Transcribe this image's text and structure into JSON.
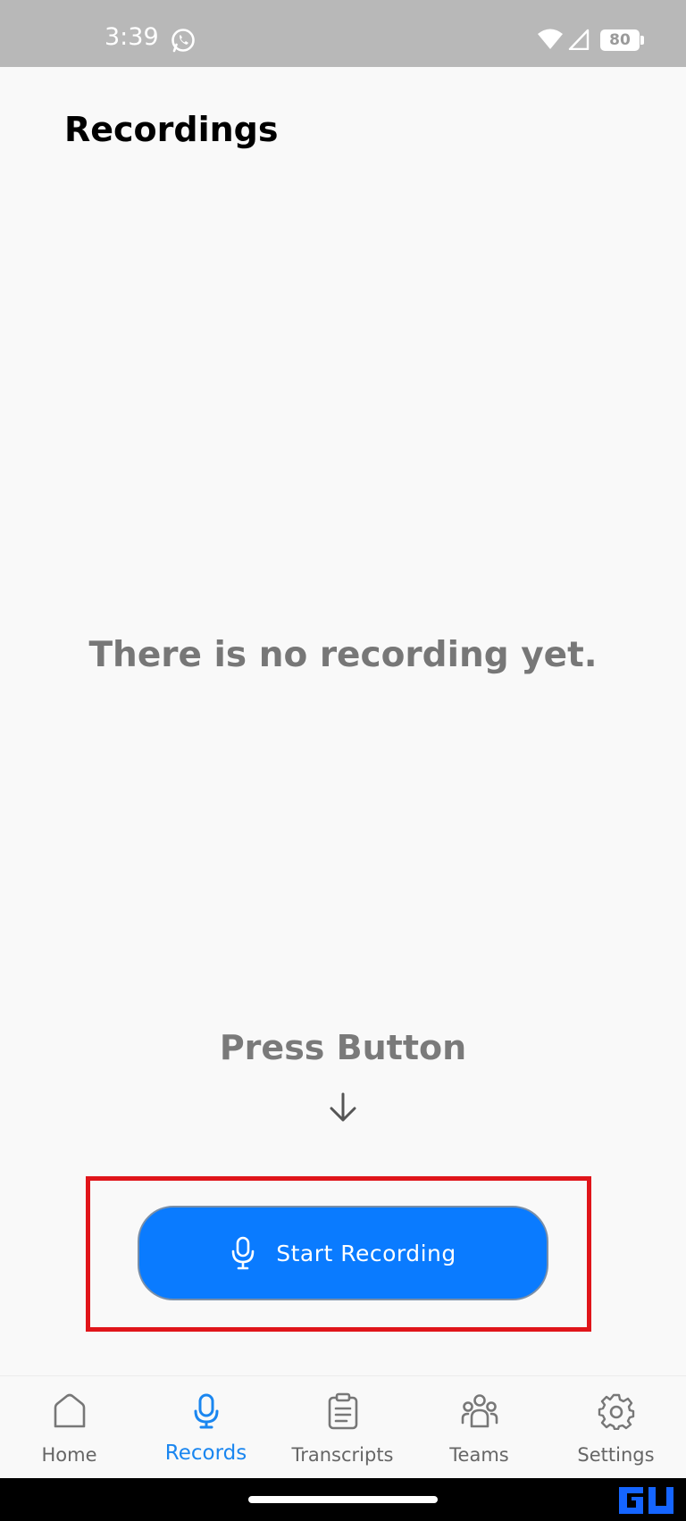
{
  "status_bar": {
    "time": "3:39",
    "battery": "80",
    "icons": [
      "whatsapp-icon",
      "wifi-icon",
      "signal-icon",
      "battery-icon"
    ]
  },
  "page": {
    "title": "Recordings",
    "empty_message": "There is no recording yet.",
    "press_label": "Press Button",
    "start_button_label": "Start Recording"
  },
  "tabs": [
    {
      "label": "Home",
      "icon": "home-icon",
      "active": false
    },
    {
      "label": "Records",
      "icon": "microphone-icon",
      "active": true
    },
    {
      "label": "Transcripts",
      "icon": "clipboard-icon",
      "active": false
    },
    {
      "label": "Teams",
      "icon": "people-icon",
      "active": false
    },
    {
      "label": "Settings",
      "icon": "gear-icon",
      "active": false
    }
  ],
  "colors": {
    "accent": "#0a7bff",
    "active_tab": "#1a86f0",
    "highlight": "#e0151a",
    "status_bar": "#b8b8b8"
  }
}
